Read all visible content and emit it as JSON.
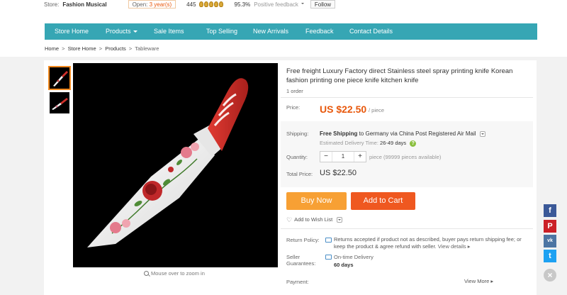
{
  "store_bar": {
    "store_label": "Store:",
    "store_name": "Fashion Musical",
    "open_label": "Open:",
    "open_years": "3 year(s)",
    "feedback_count": "445",
    "feedback_pct": "95.3%",
    "positive_label": "Positive feedback",
    "follow_label": "Follow"
  },
  "nav": {
    "items": [
      "Store Home",
      "Products",
      "Sale Items",
      "Top Selling",
      "New Arrivals",
      "Feedback",
      "Contact Details"
    ]
  },
  "breadcrumb": {
    "items": [
      "Home",
      "Store Home",
      "Products",
      "Tableware"
    ],
    "separator": ">"
  },
  "gallery": {
    "zoom_hint": "Mouse over to zoom in"
  },
  "product": {
    "title": "Free freight Luxury Factory direct Stainless steel spray printing knife Korean fashion printing one piece knife kitchen knife",
    "orders": "1 order",
    "price_label": "Price:",
    "price": "US $22.50",
    "per_unit": "/ piece",
    "shipping_label": "Shipping:",
    "shipping_free": "Free Shipping",
    "shipping_rest": "to Germany via China Post Registered Air Mail",
    "eta_label": "Estimated Delivery Time:",
    "eta_days": "26-49 days",
    "quantity_label": "Quantity:",
    "quantity_value": "1",
    "stepper_minus": "−",
    "stepper_plus": "+",
    "availability": "piece (99999 pieces available)",
    "total_label": "Total Price:",
    "total_price": "US $22.50"
  },
  "actions": {
    "buy_now": "Buy Now",
    "add_to_cart": "Add to Cart",
    "wish_list": "Add to Wish List"
  },
  "policy": {
    "return_label": "Return Policy:",
    "return_text": "Returns accepted if product not as described, buyer pays return shipping fee; or keep the product & agree refund with seller.",
    "view_details": "View details ▸",
    "guarantee_label_1": "Seller",
    "guarantee_label_2": "Guarantees:",
    "ontime_label": "On-time Delivery",
    "ontime_days": "60 days",
    "payment_label": "Payment:",
    "view_more": "View More ▸"
  },
  "social": {
    "facebook": "f",
    "pinterest": "P",
    "vk": "vk",
    "twitter": "t",
    "close": "×"
  },
  "colors": {
    "nav_bg": "#36a6b4",
    "price": "#e8580c",
    "buy_now": "#f7a034",
    "add_to_cart": "#ef5820",
    "thumb_active": "#f58a1f"
  }
}
